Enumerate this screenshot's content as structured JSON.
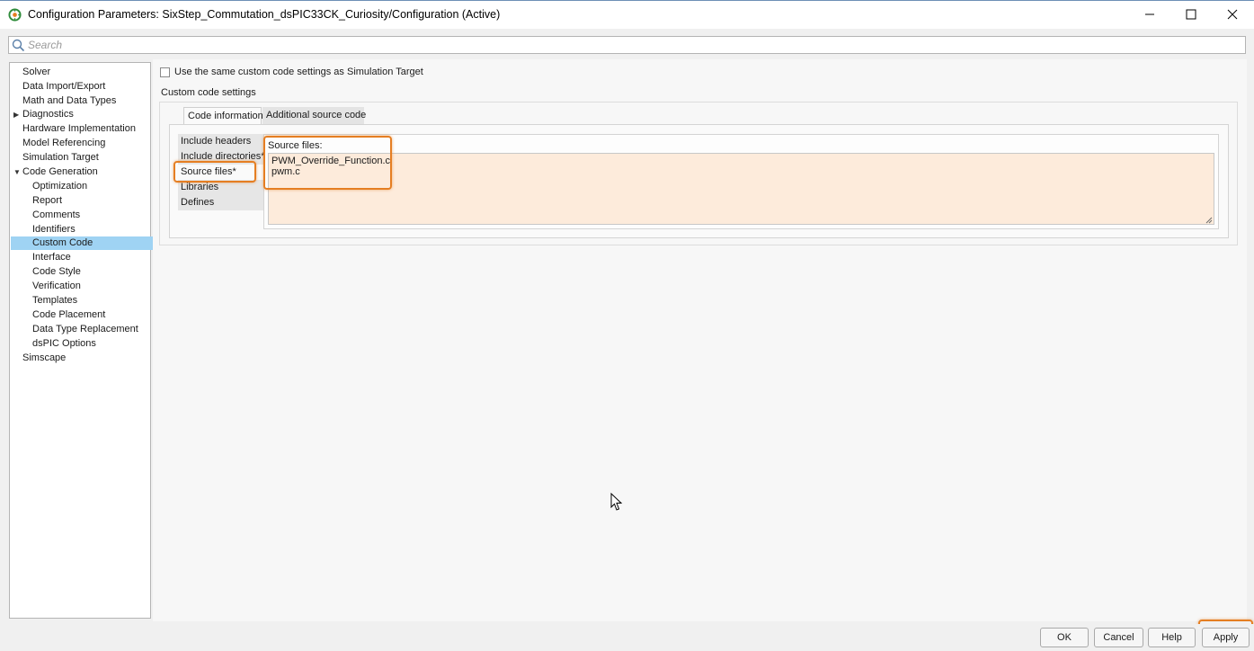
{
  "window": {
    "title": "Configuration Parameters: SixStep_Commutation_dsPIC33CK_Curiosity/Configuration (Active)",
    "icons": [
      "simulink-app-icon",
      "minimize-icon",
      "maximize-icon",
      "close-icon"
    ]
  },
  "search": {
    "placeholder": "Search",
    "icon": "search-icon"
  },
  "tree": {
    "items": [
      {
        "label": "Solver",
        "level": 0
      },
      {
        "label": "Data Import/Export",
        "level": 0
      },
      {
        "label": "Math and Data Types",
        "level": 0
      },
      {
        "label": "Diagnostics",
        "level": 0,
        "expander": "collapsed"
      },
      {
        "label": "Hardware Implementation",
        "level": 0
      },
      {
        "label": "Model Referencing",
        "level": 0
      },
      {
        "label": "Simulation Target",
        "level": 0
      },
      {
        "label": "Code Generation",
        "level": 0,
        "expander": "expanded"
      },
      {
        "label": "Optimization",
        "level": 1
      },
      {
        "label": "Report",
        "level": 1
      },
      {
        "label": "Comments",
        "level": 1
      },
      {
        "label": "Identifiers",
        "level": 1
      },
      {
        "label": "Custom Code",
        "level": 1,
        "selected": true
      },
      {
        "label": "Interface",
        "level": 1
      },
      {
        "label": "Code Style",
        "level": 1
      },
      {
        "label": "Verification",
        "level": 1
      },
      {
        "label": "Templates",
        "level": 1
      },
      {
        "label": "Code Placement",
        "level": 1
      },
      {
        "label": "Data Type Replacement",
        "level": 1
      },
      {
        "label": "dsPIC Options",
        "level": 1
      },
      {
        "label": "Simscape",
        "level": 0
      }
    ]
  },
  "custom_code": {
    "use_same_settings_label": "Use the same custom code settings as Simulation Target",
    "use_same_settings_checked": false,
    "section_label": "Custom code settings",
    "tabs": [
      {
        "label": "Code information",
        "active": true
      },
      {
        "label": "Additional source code",
        "active": false
      }
    ],
    "subsections": [
      {
        "label": "Include headers"
      },
      {
        "label": "Include directories*"
      },
      {
        "label": "Source files*",
        "active": true
      },
      {
        "label": "Libraries"
      },
      {
        "label": "Defines"
      }
    ],
    "editor_label": "Source files:",
    "source_files": [
      "PWM_Override_Function.c",
      "pwm.c"
    ]
  },
  "buttons": {
    "ok": "OK",
    "cancel": "Cancel",
    "help": "Help",
    "apply": "Apply"
  },
  "colors": {
    "highlight": "#e57e22",
    "tree_selection": "#9fd3f3",
    "editor_background": "#fdebdb"
  }
}
